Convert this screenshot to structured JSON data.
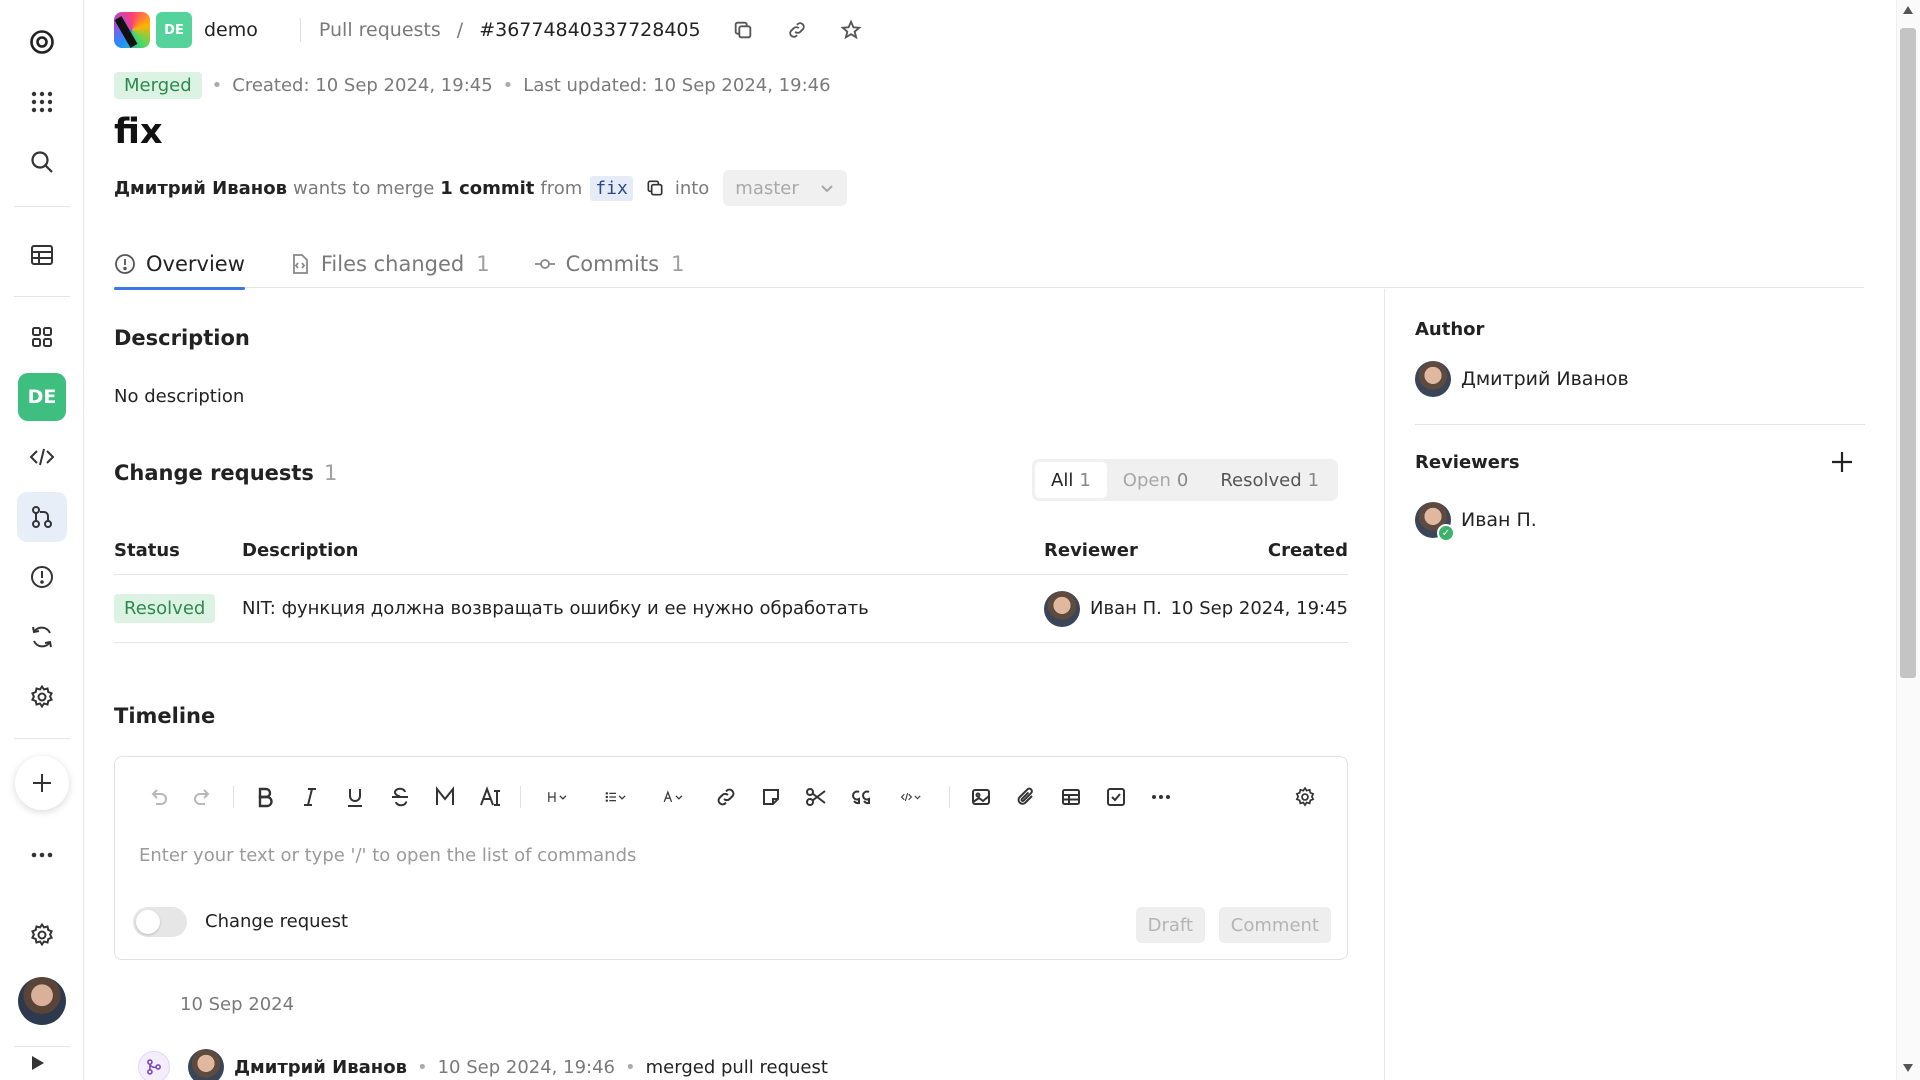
{
  "header": {
    "org_badge": "DE",
    "org_name": "demo",
    "breadcrumb_section": "Pull requests",
    "breadcrumb_sep": "/",
    "pr_id": "#36774840337728405"
  },
  "meta": {
    "status": "Merged",
    "created": "Created: 10 Sep 2024, 19:45",
    "updated": "Last updated: 10 Sep 2024, 19:46"
  },
  "title": "fix",
  "merge_line": {
    "author": "Дмитрий Иванов",
    "wants": "wants to merge",
    "commits": "1 commit",
    "from": "from",
    "source_branch": "fix",
    "into": "into",
    "target_branch": "master"
  },
  "tabs": [
    {
      "label": "Overview",
      "count": ""
    },
    {
      "label": "Files changed",
      "count": "1"
    },
    {
      "label": "Commits",
      "count": "1"
    }
  ],
  "description": {
    "heading": "Description",
    "text": "No description"
  },
  "change_requests": {
    "heading": "Change requests",
    "count": "1",
    "filters": [
      {
        "label": "All",
        "count": "1"
      },
      {
        "label": "Open",
        "count": "0"
      },
      {
        "label": "Resolved",
        "count": "1"
      }
    ],
    "columns": {
      "status": "Status",
      "description": "Description",
      "reviewer": "Reviewer",
      "created": "Created"
    },
    "rows": [
      {
        "status": "Resolved",
        "description": "NIT: функция должна возвращать ошибку и ее нужно обработать",
        "reviewer": "Иван П.",
        "created": "10 Sep 2024, 19:45"
      }
    ]
  },
  "timeline": {
    "heading": "Timeline",
    "editor_placeholder": "Enter your text or type '/' to open the list of commands",
    "toggle_label": "Change request",
    "draft_label": "Draft",
    "comment_label": "Comment",
    "date": "10 Sep 2024",
    "event": {
      "author": "Дмитрий Иванов",
      "time": "10 Sep 2024, 19:46",
      "action": "merged pull request"
    }
  },
  "sidebar_right": {
    "author_heading": "Author",
    "author_name": "Дмитрий Иванов",
    "reviewers_heading": "Reviewers",
    "reviewers": [
      "Иван П."
    ]
  },
  "rail": {
    "org_badge": "DE"
  },
  "colors": {
    "accent": "#3b78e7",
    "merged_bg": "#dcf2e3",
    "merged_fg": "#2c8a4c",
    "org_green": "#3fbf7f"
  }
}
